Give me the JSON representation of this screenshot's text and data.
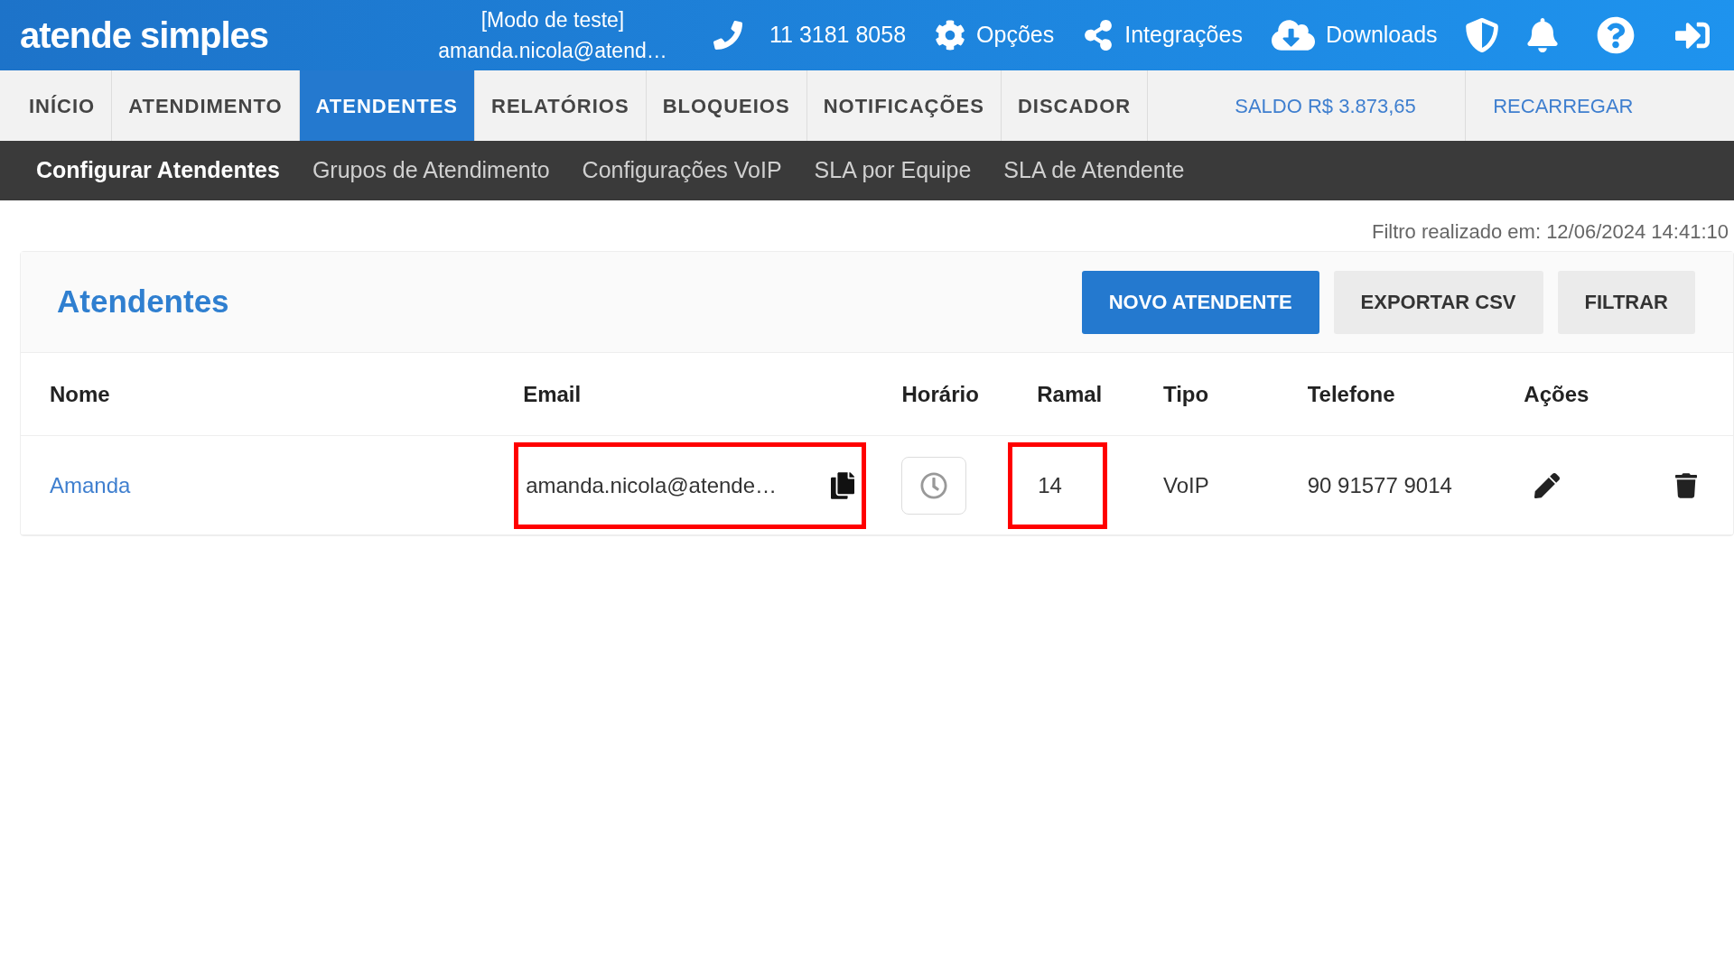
{
  "header": {
    "logo": "atende simples",
    "mode": "[Modo de teste]",
    "user": "amanda.nicola@atend…",
    "phone": "11 3181 8058",
    "links": [
      {
        "kind": "options",
        "label": "Opções"
      },
      {
        "kind": "integrations",
        "label": "Integrações"
      },
      {
        "kind": "downloads",
        "label": "Downloads"
      }
    ]
  },
  "nav": {
    "tabs": [
      {
        "label": "INÍCIO",
        "selected": false
      },
      {
        "label": "ATENDIMENTO",
        "selected": false
      },
      {
        "label": "ATENDENTES",
        "selected": true
      },
      {
        "label": "RELATÓRIOS",
        "selected": false
      },
      {
        "label": "BLOQUEIOS",
        "selected": false
      },
      {
        "label": "NOTIFICAÇÕES",
        "selected": false
      },
      {
        "label": "DISCADOR",
        "selected": false
      }
    ],
    "balance": "SALDO R$ 3.873,65",
    "recharge": "RECARREGAR"
  },
  "subnav": [
    {
      "label": "Configurar Atendentes",
      "selected": true
    },
    {
      "label": "Grupos de Atendimento",
      "selected": false
    },
    {
      "label": "Configurações VoIP",
      "selected": false
    },
    {
      "label": "SLA por Equipe",
      "selected": false
    },
    {
      "label": "SLA de Atendente",
      "selected": false
    }
  ],
  "filter_info": "Filtro realizado em: 12/06/2024 14:41:10",
  "card": {
    "title": "Atendentes",
    "buttons": [
      {
        "label": "NOVO ATENDENTE",
        "kind": "primary"
      },
      {
        "label": "EXPORTAR CSV",
        "kind": "secondary"
      },
      {
        "label": "FILTRAR",
        "kind": "secondary"
      }
    ]
  },
  "table": {
    "columns": [
      "Nome",
      "Email",
      "Horário",
      "Ramal",
      "Tipo",
      "Telefone",
      "Ações"
    ],
    "rows": [
      {
        "name": "Amanda",
        "email": "amanda.nicola@atende…",
        "email_highlighted": true,
        "ramal": "14",
        "ramal_highlighted": true,
        "tipo": "VoIP",
        "telefone": "90 91577 9014"
      }
    ]
  }
}
